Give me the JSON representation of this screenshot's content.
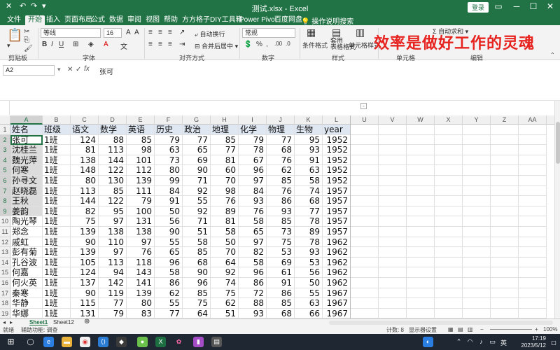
{
  "titlebar": {
    "title": "测试.xlsx  -  Excel",
    "login": "登录",
    "quick_access": [
      "✕",
      "↶",
      "↷",
      "▾"
    ]
  },
  "tabs": [
    {
      "label": "文件",
      "active": false
    },
    {
      "label": "开始",
      "active": true
    },
    {
      "label": "插入",
      "active": false
    },
    {
      "label": "页面布局",
      "active": false
    },
    {
      "label": "公式",
      "active": false
    },
    {
      "label": "数据",
      "active": false
    },
    {
      "label": "审阅",
      "active": false
    },
    {
      "label": "视图",
      "active": false
    },
    {
      "label": "帮助",
      "active": false
    },
    {
      "label": "方方格子",
      "active": false
    },
    {
      "label": "DIY工具箱",
      "active": false
    },
    {
      "label": "Power Pivot",
      "active": false
    },
    {
      "label": "百度网盘",
      "active": false
    }
  ],
  "tell_me": "操作说明搜索",
  "ribbon": {
    "font_name": "等线",
    "font_size": "16",
    "number_format": "常规",
    "wrap_text": "自动换行",
    "merge_center": "合并后居中",
    "cond_format": "条件格式",
    "table_format": "套用\n表格格式",
    "cell_style": "单元格样式",
    "autosum": "自动求和",
    "groups": {
      "clipboard": "剪贴板",
      "font": "字体",
      "alignment": "对齐方式",
      "number": "数字",
      "styles": "样式",
      "cells": "单元格",
      "editing": "编辑"
    },
    "overlay_text": "效率是做好工作的灵魂"
  },
  "formula_bar": {
    "name_box": "A2",
    "value": "张可"
  },
  "columns": [
    "A",
    "B",
    "C",
    "D",
    "E",
    "F",
    "G",
    "H",
    "I",
    "J",
    "K",
    "L",
    "U",
    "V",
    "W",
    "X",
    "Y",
    "Z",
    "AA"
  ],
  "table": {
    "headers": [
      "姓名",
      "班级",
      "语文",
      "数学",
      "英语",
      "历史",
      "政治",
      "地理",
      "化学",
      "物理",
      "生物",
      "year"
    ],
    "rows": [
      [
        "张可",
        "1班",
        "124",
        "88",
        "85",
        "79",
        "77",
        "85",
        "79",
        "77",
        "95",
        "1952"
      ],
      [
        "沈桂兰",
        "1班",
        "81",
        "113",
        "98",
        "63",
        "65",
        "77",
        "78",
        "68",
        "93",
        "1952"
      ],
      [
        "魏光萍",
        "1班",
        "138",
        "144",
        "101",
        "73",
        "69",
        "81",
        "67",
        "76",
        "91",
        "1952"
      ],
      [
        "何寒",
        "1班",
        "148",
        "122",
        "112",
        "80",
        "90",
        "60",
        "96",
        "62",
        "63",
        "1952"
      ],
      [
        "孙寻文",
        "1班",
        "80",
        "130",
        "139",
        "99",
        "71",
        "70",
        "97",
        "85",
        "58",
        "1952"
      ],
      [
        "赵晓磊",
        "1班",
        "113",
        "85",
        "111",
        "84",
        "92",
        "98",
        "84",
        "76",
        "74",
        "1957"
      ],
      [
        "王秋",
        "1班",
        "144",
        "122",
        "79",
        "91",
        "55",
        "76",
        "93",
        "86",
        "68",
        "1957"
      ],
      [
        "姜韵",
        "1班",
        "82",
        "95",
        "100",
        "50",
        "92",
        "89",
        "76",
        "93",
        "77",
        "1957"
      ],
      [
        "陶光琴",
        "1班",
        "75",
        "97",
        "131",
        "56",
        "71",
        "81",
        "58",
        "85",
        "78",
        "1957"
      ],
      [
        "郑念",
        "1班",
        "139",
        "138",
        "138",
        "90",
        "51",
        "58",
        "65",
        "73",
        "89",
        "1957"
      ],
      [
        "戚虹",
        "1班",
        "90",
        "110",
        "97",
        "55",
        "58",
        "50",
        "97",
        "75",
        "78",
        "1962"
      ],
      [
        "彭有菊",
        "1班",
        "139",
        "97",
        "76",
        "65",
        "85",
        "70",
        "82",
        "53",
        "93",
        "1962"
      ],
      [
        "孔谷波",
        "1班",
        "105",
        "113",
        "118",
        "96",
        "68",
        "64",
        "58",
        "69",
        "53",
        "1962"
      ],
      [
        "何嘉",
        "1班",
        "124",
        "94",
        "143",
        "58",
        "90",
        "92",
        "96",
        "61",
        "56",
        "1962"
      ],
      [
        "何火英",
        "1班",
        "137",
        "142",
        "141",
        "86",
        "96",
        "74",
        "86",
        "91",
        "50",
        "1962"
      ],
      [
        "秦寒",
        "1班",
        "90",
        "119",
        "139",
        "62",
        "85",
        "75",
        "72",
        "86",
        "55",
        "1967"
      ],
      [
        "华静",
        "1班",
        "115",
        "77",
        "80",
        "55",
        "75",
        "62",
        "88",
        "85",
        "63",
        "1967"
      ],
      [
        "华娜",
        "1班",
        "131",
        "79",
        "83",
        "77",
        "64",
        "51",
        "93",
        "68",
        "66",
        "1967"
      ]
    ]
  },
  "sheets": [
    "Sheet1",
    "Sheet12"
  ],
  "status": {
    "ready": "就绪",
    "accessibility": "辅助功能: 调查",
    "count": "计数: 8",
    "display": "显示器设置",
    "zoom": "100%"
  },
  "taskbar": {
    "ime": "英",
    "time": "17:19",
    "date": "2023/5/12"
  },
  "colors": {
    "excel_green": "#217346",
    "header_fill": "#dfe7f2",
    "name_fill": "#dcdcdc",
    "overlay_red": "#e6231f"
  }
}
